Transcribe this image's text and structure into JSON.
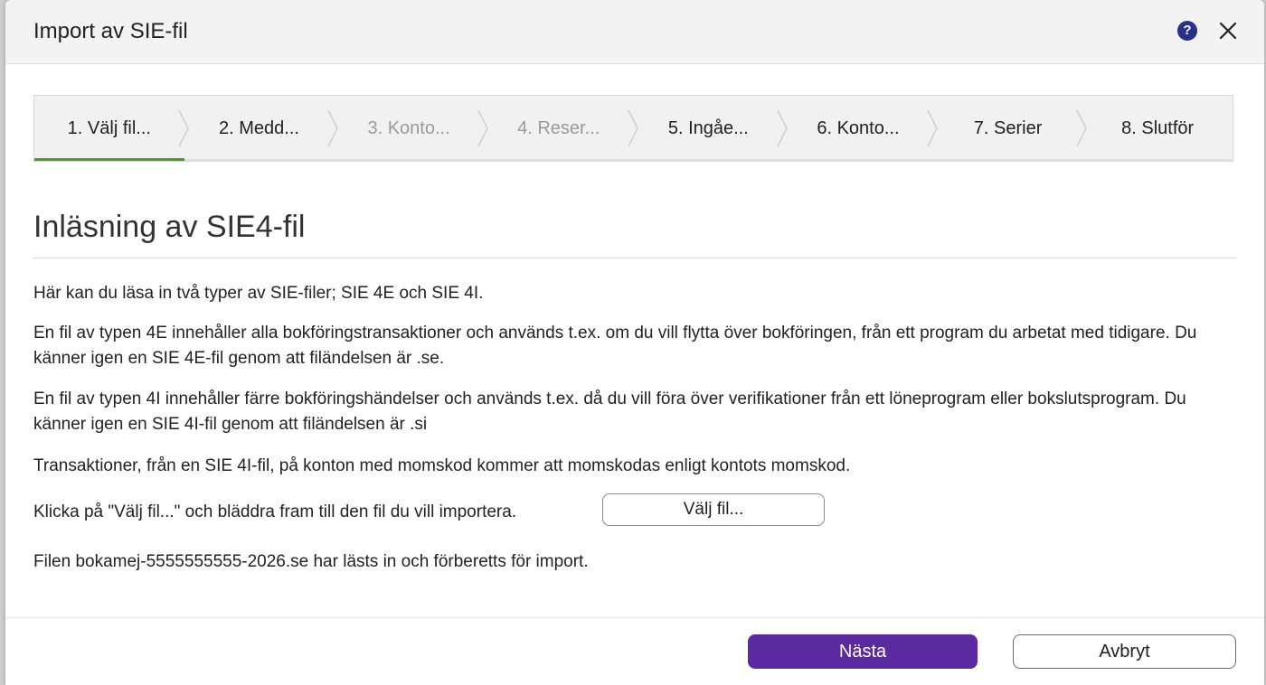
{
  "dialog": {
    "title": "Import av SIE-fil",
    "help_icon": "question-circle-icon",
    "close_icon": "close-icon"
  },
  "steps": [
    {
      "label": "1. Välj fil...",
      "state": "active"
    },
    {
      "label": "2. Medd...",
      "state": "enabled"
    },
    {
      "label": "3. Konto...",
      "state": "disabled"
    },
    {
      "label": "4. Reser...",
      "state": "disabled"
    },
    {
      "label": "5. Ingåe...",
      "state": "enabled"
    },
    {
      "label": "6. Konto...",
      "state": "enabled"
    },
    {
      "label": "7. Serier",
      "state": "enabled"
    },
    {
      "label": "8. Slutför",
      "state": "enabled"
    }
  ],
  "content": {
    "heading": "Inläsning av SIE4-fil",
    "para1": "Här kan du läsa in två typer av SIE-filer; SIE 4E och SIE 4I.",
    "para2": "En fil av typen 4E innehåller alla bokföringstransaktioner och används t.ex. om du vill flytta över bokföringen, från ett program du arbetat med tidigare. Du känner igen en SIE 4E-fil genom att filändelsen är .se.",
    "para3": "En fil av typen 4I innehåller färre bokföringshändelser och används t.ex. då du vill föra över verifikationer från ett löneprogram eller bokslutsprogram. Du känner igen en SIE 4I-fil genom att filändelsen är .si",
    "para4": "Transaktioner, från en SIE 4I-fil, på konton med momskod kommer att momskodas enligt kontots momskod.",
    "choose_instruction": "Klicka på \"Välj fil...\" och bläddra fram till den fil du vill importera.",
    "choose_button": "Välj fil...",
    "status": "Filen bokamej-5555555555-2026.se har lästs in och förberetts för import."
  },
  "footer": {
    "next_label": "Nästa",
    "cancel_label": "Avbryt"
  },
  "colors": {
    "active_step_underline": "#4b9a2b",
    "primary_button": "#5b2aa0",
    "help_icon": "#27318b"
  }
}
